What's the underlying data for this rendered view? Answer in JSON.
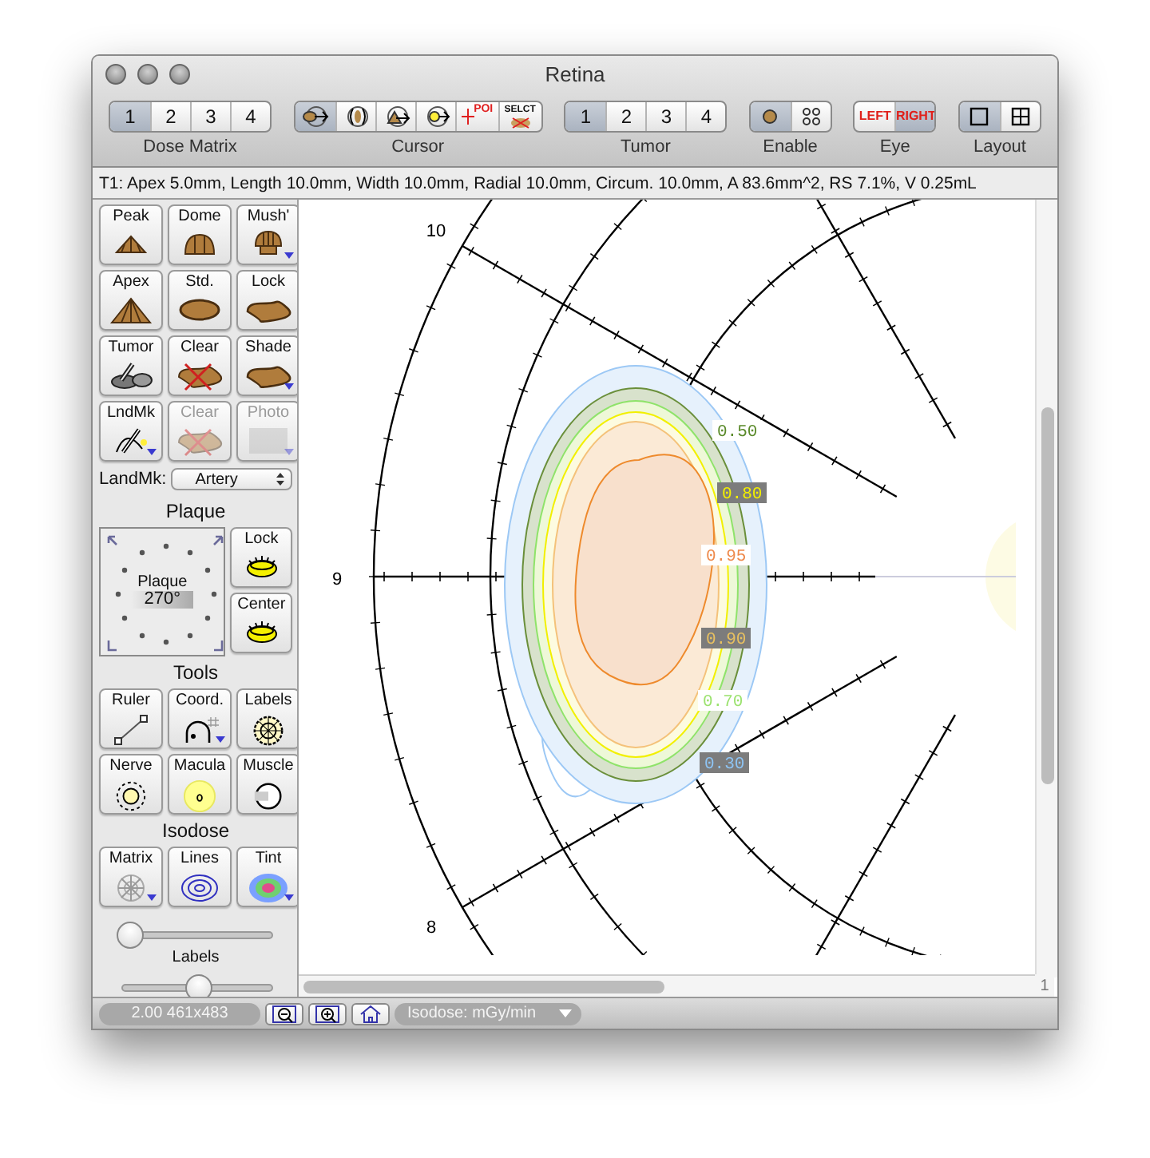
{
  "window": {
    "title": "Retina"
  },
  "toolbar": [
    {
      "label": "Dose Matrix",
      "kind": "text",
      "buttons": [
        {
          "label": "1",
          "selected": true
        },
        {
          "label": "2",
          "selected": false
        },
        {
          "label": "3",
          "selected": false
        },
        {
          "label": "4",
          "selected": false
        }
      ]
    },
    {
      "label": "Cursor",
      "kind": "icon",
      "buttons": [
        {
          "kind": "body-arrow",
          "selected": true
        },
        {
          "kind": "lens",
          "selected": false
        },
        {
          "kind": "tumor-arrow",
          "selected": false
        },
        {
          "kind": "dot-arrow",
          "selected": false
        },
        {
          "kind": "poi",
          "label": "POI",
          "selected": false
        },
        {
          "kind": "select",
          "label": "SELCT",
          "selected": false
        }
      ]
    },
    {
      "label": "Tumor",
      "kind": "text",
      "buttons": [
        {
          "label": "1",
          "selected": true
        },
        {
          "label": "2",
          "selected": false
        },
        {
          "label": "3",
          "selected": false
        },
        {
          "label": "4",
          "selected": false
        }
      ]
    },
    {
      "label": "Enable",
      "kind": "icon",
      "buttons": [
        {
          "kind": "single-dot",
          "selected": true
        },
        {
          "kind": "four-dots",
          "selected": false
        }
      ]
    },
    {
      "label": "Eye",
      "kind": "eye",
      "buttons": [
        {
          "label": "LEFT",
          "selected": false
        },
        {
          "label": "RIGHT",
          "selected": true
        }
      ]
    },
    {
      "label": "Layout",
      "kind": "icon",
      "buttons": [
        {
          "kind": "single-pane",
          "selected": true
        },
        {
          "kind": "four-panes",
          "selected": false
        }
      ]
    }
  ],
  "info_line": "T1: Apex 5.0mm, Length 10.0mm, Width 10.0mm, Radial 10.0mm, Circum. 10.0mm, A 83.6mm^2, RS 7.1%, V 0.25mL",
  "sidebar": {
    "shape_buttons": [
      {
        "label": "Peak",
        "kind": "peak",
        "menu": false,
        "disabled": false
      },
      {
        "label": "Dome",
        "kind": "dome",
        "menu": false,
        "disabled": false
      },
      {
        "label": "Mush'",
        "kind": "mushroom",
        "menu": true,
        "disabled": false
      },
      {
        "label": "Apex",
        "kind": "apex",
        "menu": false,
        "disabled": false
      },
      {
        "label": "Std.",
        "kind": "oval",
        "menu": false,
        "disabled": false
      },
      {
        "label": "Lock",
        "kind": "blob",
        "menu": false,
        "disabled": false
      },
      {
        "label": "Tumor",
        "kind": "tumor",
        "menu": false,
        "disabled": false
      },
      {
        "label": "Clear",
        "kind": "clear",
        "menu": false,
        "disabled": false
      },
      {
        "label": "Shade",
        "kind": "blob",
        "menu": true,
        "disabled": false
      },
      {
        "label": "LndMk",
        "kind": "landmark",
        "menu": true,
        "disabled": false
      },
      {
        "label": "Clear",
        "kind": "clear",
        "menu": false,
        "disabled": true
      },
      {
        "label": "Photo",
        "kind": "photo",
        "menu": true,
        "disabled": true
      }
    ],
    "landmark_select": {
      "label": "LandMk:",
      "value": "Artery"
    },
    "plaque": {
      "heading": "Plaque",
      "dial_label": "Plaque",
      "angle": "270°",
      "buttons": [
        {
          "label": "Lock",
          "kind": "plaque"
        },
        {
          "label": "Center",
          "kind": "plaque"
        }
      ]
    },
    "tools": {
      "heading": "Tools",
      "buttons": [
        {
          "label": "Ruler",
          "kind": "ruler",
          "menu": false
        },
        {
          "label": "Coord.",
          "kind": "arch",
          "menu": true
        },
        {
          "label": "Labels",
          "kind": "wheel",
          "menu": false
        },
        {
          "label": "Nerve",
          "kind": "nerve",
          "menu": false
        },
        {
          "label": "Macula",
          "kind": "macula",
          "menu": false
        },
        {
          "label": "Muscle",
          "kind": "muscle",
          "menu": false
        }
      ]
    },
    "isodose": {
      "heading": "Isodose",
      "buttons": [
        {
          "label": "Matrix",
          "kind": "web",
          "menu": true
        },
        {
          "label": "Lines",
          "kind": "rings",
          "menu": false
        },
        {
          "label": "Tint",
          "kind": "tint",
          "menu": true
        }
      ]
    },
    "slider_top": {
      "level": 0.05
    },
    "slider_labels": {
      "label": "Labels",
      "level": 0.5
    }
  },
  "canvas": {
    "clock_labels": [
      "10",
      "9",
      "8"
    ],
    "isodose_labels": [
      {
        "text": "0.50",
        "color": "#5a8a2a",
        "boxed": false
      },
      {
        "text": "0.80",
        "color": "#f2f000",
        "boxed": true
      },
      {
        "text": "0.95",
        "color": "#ee8a4c",
        "boxed": false
      },
      {
        "text": "0.90",
        "color": "#e8c060",
        "boxed": true
      },
      {
        "text": "0.70",
        "color": "#9be26e",
        "boxed": false
      },
      {
        "text": "0.30",
        "color": "#8ec4f4",
        "boxed": true
      }
    ],
    "page_number": "1"
  },
  "status_bar": {
    "readout": "2.00 461x483",
    "isodose_menu": "Isodose: mGy/min"
  }
}
